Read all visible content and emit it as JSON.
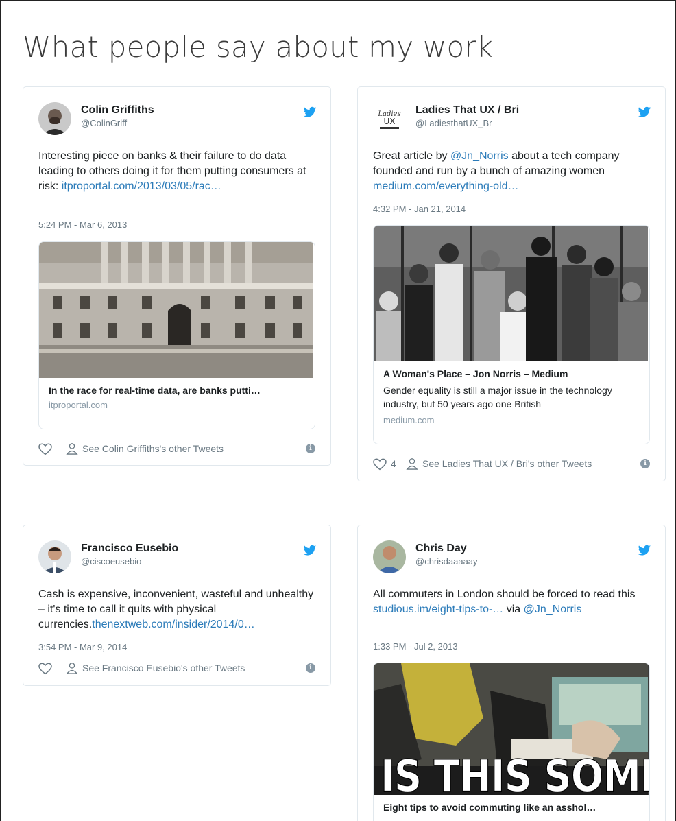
{
  "page": {
    "title": "What people say about my work"
  },
  "colors": {
    "twitter_blue": "#1da1f2",
    "link": "#2b7bb9",
    "muted": "#697882"
  },
  "tweets": [
    {
      "name": "Colin Griffiths",
      "handle": "@ColinGriff",
      "text": "Interesting piece on banks & their failure to do data leading to others doing it for them putting consumers at risk:",
      "link": "itproportal.com/2013/03/05/rac…",
      "time": "5:24 PM - Mar 6, 2013",
      "card": {
        "title": "In the race for real-time data, are banks putti…",
        "domain": "itproportal.com"
      },
      "other": "See Colin Griffiths's other Tweets"
    },
    {
      "name": "Ladies That UX / Bri",
      "handle": "@LadiesthatUX_Br",
      "text_pre": "Great article by",
      "mention": "@Jn_Norris",
      "text_mid": "about a tech company founded and run by a bunch of amazing women",
      "link": "medium.com/everything-old…",
      "time": "4:32 PM - Jan 21, 2014",
      "card": {
        "title": "A Woman's Place – Jon Norris – Medium",
        "desc": "Gender equality is still a major issue in the technology industry, but 50 years ago one British",
        "domain": "medium.com"
      },
      "likes": "4",
      "other": "See Ladies That UX / Bri's other Tweets",
      "avatar_text": "Ladies that UX"
    },
    {
      "name": "Francisco Eusebio",
      "handle": "@ciscoeusebio",
      "text": "Cash is expensive, inconvenient, wasteful and unhealthy – it's time to call it quits with physical currencies.",
      "link": "thenextweb.com/insider/2014/0…",
      "time": "3:54 PM - Mar 9, 2014",
      "other": "See Francisco Eusebio's other Tweets"
    },
    {
      "name": "Chris Day",
      "handle": "@chrisdaaaaay",
      "text": "All commuters in London should be forced to read this",
      "link": "studious.im/eight-tips-to-…",
      "via": "via",
      "mention": "@Jn_Norris",
      "time": "1:33 PM - Jul 2, 2013",
      "card": {
        "title": "Eight tips to avoid commuting like an asshol…",
        "image_text": "IS THIS SOME"
      }
    }
  ]
}
